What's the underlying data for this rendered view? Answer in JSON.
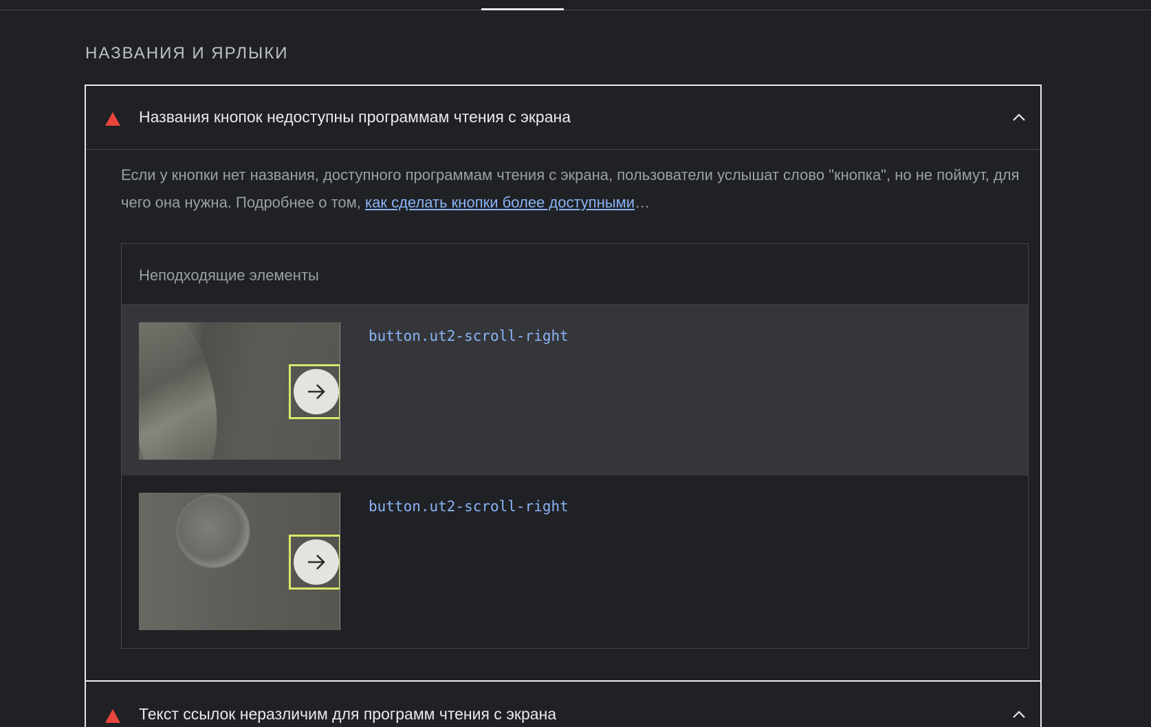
{
  "group": {
    "title": "НАЗВАНИЯ И ЯРЛЫКИ"
  },
  "audits": [
    {
      "title": "Названия кнопок недоступны программам чтения с экрана",
      "status_icon": "fail-triangle-icon",
      "expanded": true,
      "description_text": "Если у кнопки нет названия, доступного программам чтения с экрана, пользователи услышат слово \"кнопка\", но не поймут, для чего она нужна. Подробнее о том, ",
      "description_link": "как сделать кнопки более доступными",
      "description_tail": "…",
      "table_header": "Неподходящие элементы",
      "items": [
        {
          "selector": "button.ut2-scroll-right"
        },
        {
          "selector": "button.ut2-scroll-right"
        }
      ]
    },
    {
      "title": "Текст ссылок неразличим для программ чтения с экрана",
      "status_icon": "fail-triangle-icon",
      "expanded": true
    }
  ],
  "colors": {
    "background": "#202124",
    "fail": "#e8453c",
    "link": "#8ab4f8",
    "highlight": "#d9e86a"
  }
}
